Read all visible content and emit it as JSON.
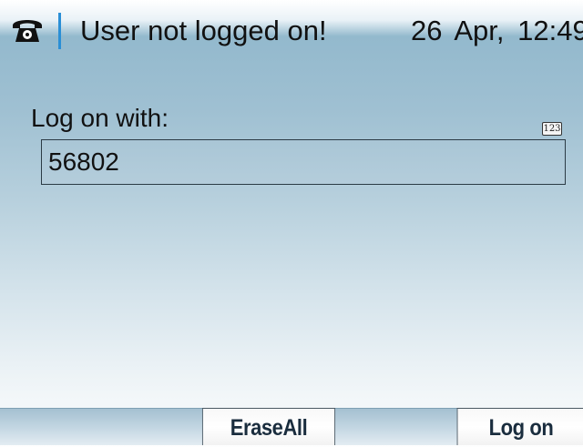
{
  "status_bar": {
    "icon": "phone-icon",
    "title": "User not logged on!",
    "datetime": "26 Apr,   12:49"
  },
  "logon": {
    "label": "Log on with:",
    "input_mode": "123",
    "value": "56802"
  },
  "softkeys": {
    "erase_all": "EraseAll",
    "log_on": "Log on"
  },
  "colors": {
    "accent": "#2a8fd6",
    "text": "#111111",
    "softkey_text": "#1a2d3e"
  }
}
